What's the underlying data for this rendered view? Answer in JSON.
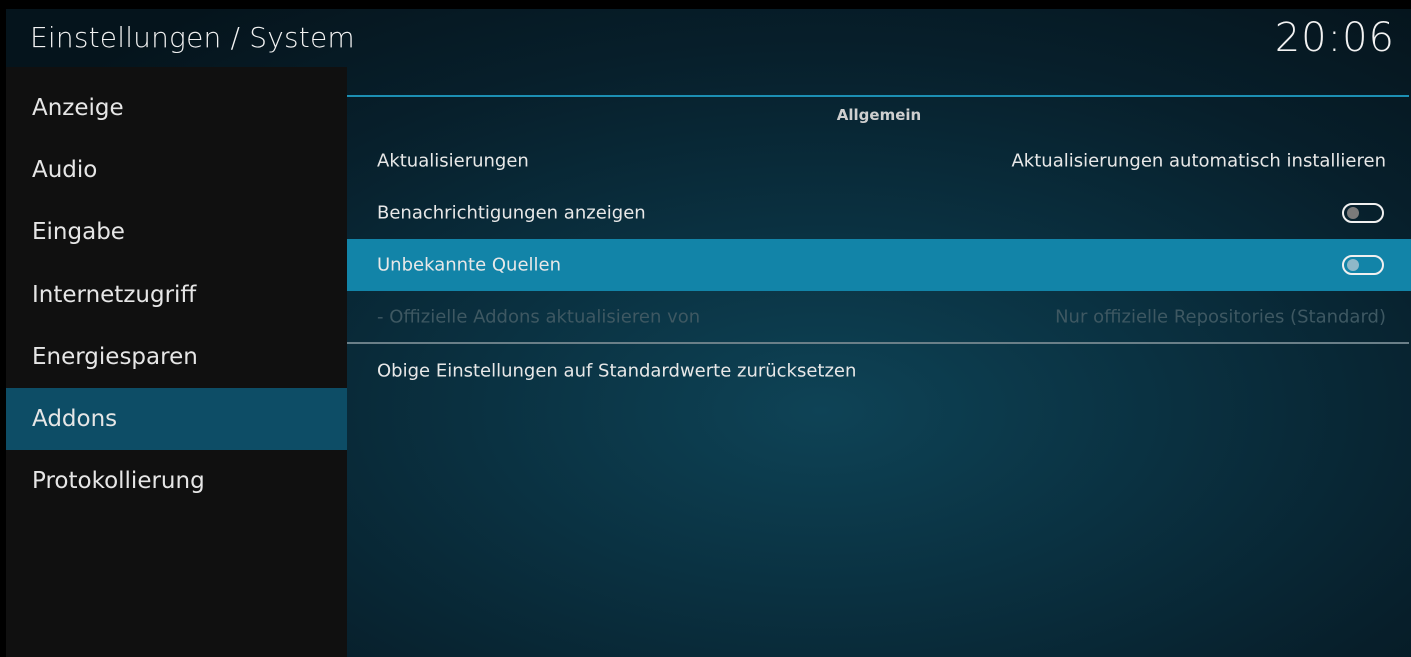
{
  "header": {
    "title": "Einstellungen / System",
    "clock": "20:06"
  },
  "sidebar": {
    "items": [
      {
        "label": "Anzeige",
        "active": false
      },
      {
        "label": "Audio",
        "active": false
      },
      {
        "label": "Eingabe",
        "active": false
      },
      {
        "label": "Internetzugriff",
        "active": false
      },
      {
        "label": "Energiesparen",
        "active": false
      },
      {
        "label": "Addons",
        "active": true
      },
      {
        "label": "Protokollierung",
        "active": false
      }
    ]
  },
  "main": {
    "section_title": "Allgemein",
    "settings": [
      {
        "label": "Aktualisierungen",
        "value": "Aktualisierungen automatisch installieren",
        "type": "select"
      },
      {
        "label": "Benachrichtigungen anzeigen",
        "type": "toggle",
        "checked": false
      },
      {
        "label": "Unbekannte Quellen",
        "type": "toggle",
        "checked": false,
        "focused": true
      },
      {
        "label": "- Offizielle Addons aktualisieren von",
        "value": "Nur offizielle Repositories (Standard)",
        "type": "select",
        "disabled": true
      }
    ],
    "reset_label": "Obige Einstellungen auf Standardwerte zurücksetzen"
  },
  "colors": {
    "accent": "#1284a8",
    "sidebar_active": "#0d4d66",
    "section_line": "#1c8fb3"
  }
}
